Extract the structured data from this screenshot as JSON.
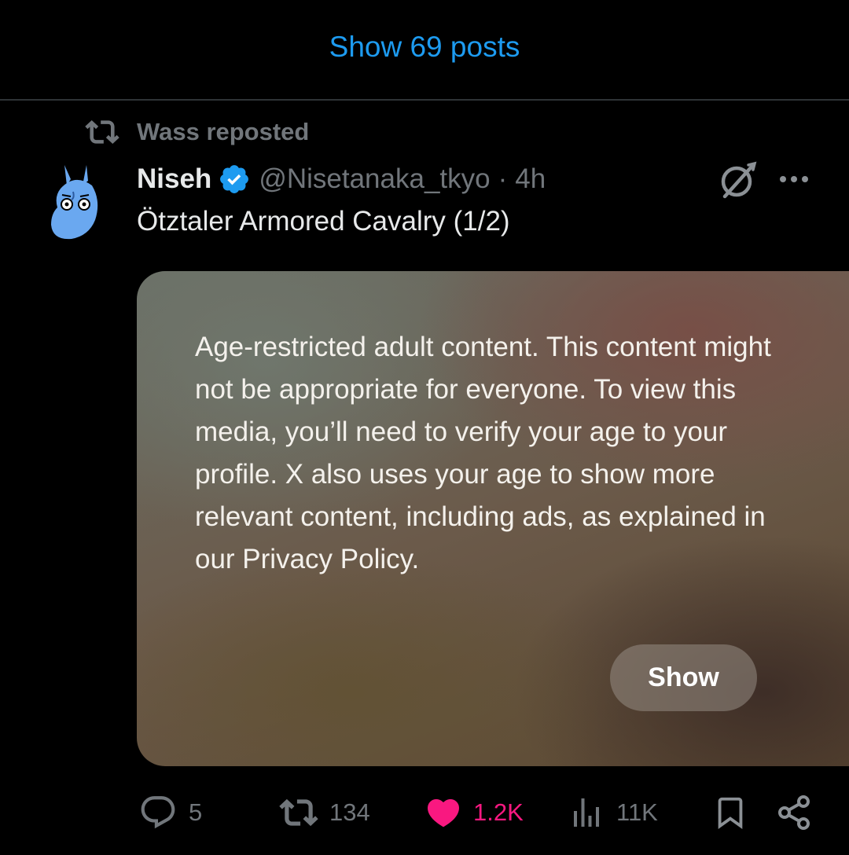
{
  "timeline": {
    "show_posts_label": "Show 69 posts"
  },
  "tweet": {
    "repost_label": "Wass reposted",
    "author_name": "Niseh",
    "author_handle": "@Nisetanaka_tkyo",
    "separator": "·",
    "time": "4h",
    "text": "Ötztaler Armored Cavalry (1/2)",
    "media_notice": "Age-restricted adult content. This content might not be appropriate for everyone. To view this media, you’ll need to verify your age to your profile. X also uses your age to show more relevant content, including ads, as explained in our Privacy Policy.",
    "show_button_label": "Show",
    "actions": {
      "replies": "5",
      "reposts": "134",
      "likes": "1.2K",
      "views": "11K"
    }
  },
  "colors": {
    "accent_blue": "#1d9bf0",
    "like_pink": "#f91880",
    "muted_gray": "#71767b",
    "background": "#000000"
  },
  "icons": {
    "repost": "repost-icon",
    "verified": "verified-badge-icon",
    "grok": "grok-icon",
    "more": "more-icon",
    "reply": "reply-icon",
    "like": "heart-icon",
    "views": "views-icon",
    "bookmark": "bookmark-icon",
    "share": "share-icon"
  }
}
